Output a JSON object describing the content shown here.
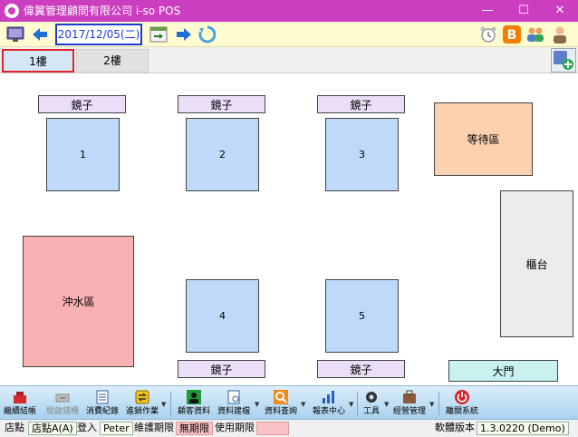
{
  "window": {
    "title": "偉翼管理顧問有限公司 i-so POS",
    "minimize": "—",
    "maximize": "☐",
    "close": "✕"
  },
  "toolbar": {
    "date": "2017/12/05(二)"
  },
  "tabs": [
    {
      "label": "1樓",
      "active": true
    },
    {
      "label": "2樓",
      "active": false
    }
  ],
  "floor": {
    "mirrors": [
      "鏡子",
      "鏡子",
      "鏡子",
      "鏡子",
      "鏡子"
    ],
    "tables": [
      "1",
      "2",
      "3",
      "4",
      "5"
    ],
    "waiting_area": "等待區",
    "shower_area": "沖水區",
    "counter": "櫃台",
    "door": "大門"
  },
  "funcbar": {
    "items": [
      {
        "label": "繼續結帳",
        "icon": "cash-register-icon"
      },
      {
        "label": "開啟錢櫃",
        "icon": "cash-drawer-icon"
      },
      {
        "label": "消費紀錄",
        "icon": "record-list-icon"
      },
      {
        "label": "進銷作業",
        "icon": "inventory-icon"
      },
      {
        "label": "顧客資料",
        "icon": "customer-icon"
      },
      {
        "label": "資料建檔",
        "icon": "data-entry-icon"
      },
      {
        "label": "資料查詢",
        "icon": "query-icon"
      },
      {
        "label": "報表中心",
        "icon": "report-icon"
      },
      {
        "label": "工具",
        "icon": "tools-gear-icon"
      },
      {
        "label": "經營管理",
        "icon": "management-icon"
      },
      {
        "label": "離開系統",
        "icon": "exit-power-icon"
      }
    ]
  },
  "status": {
    "store_label": "店點",
    "store_value": "店點A(A)",
    "login_label": "登入",
    "login_value": "Peter",
    "maintenance_label": "維護期限",
    "maintenance_value": "無期限",
    "usage_label": "使用期限",
    "usage_value": "",
    "version_label": "軟體版本",
    "version_value": "1.3.0220 (Demo)"
  },
  "colors": {
    "titlebar": "#cc3ec0",
    "toolbar": "#fffbd0",
    "active_tab_border": "#e0222a",
    "date_border": "#1d39d8",
    "table": "#bed9f9",
    "mirror": "#ebdff8",
    "waiting": "#fcd1b0",
    "shower": "#f9b0b2",
    "door": "#c8f1ef"
  }
}
